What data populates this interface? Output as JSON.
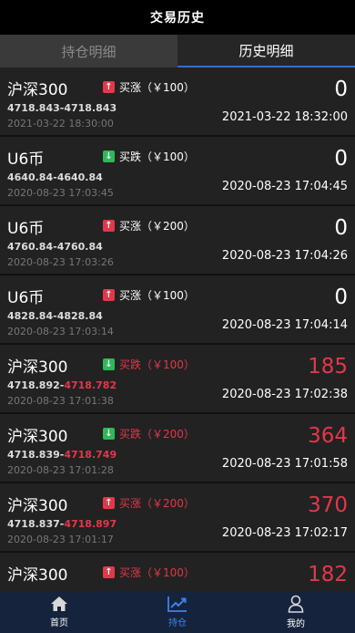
{
  "header": {
    "title": "交易历史"
  },
  "tabs": [
    {
      "label": "持仓明细",
      "active": false
    },
    {
      "label": "历史明细",
      "active": true
    }
  ],
  "trades": [
    {
      "name": "沪深300",
      "direction": "up",
      "direction_text": "买涨（￥100）",
      "open_price": "4718.843",
      "close_price": "4718.843",
      "open_time": "2021-03-22 18:30:00",
      "pnl": "0",
      "close_time": "2021-03-22 18:32:00",
      "loss": false
    },
    {
      "name": "U6币",
      "direction": "down",
      "direction_text": "买跌（￥100）",
      "open_price": "4640.84",
      "close_price": "4640.84",
      "open_time": "2020-08-23 17:03:45",
      "pnl": "0",
      "close_time": "2020-08-23 17:04:45",
      "loss": false
    },
    {
      "name": "U6币",
      "direction": "up",
      "direction_text": "买涨（￥200）",
      "open_price": "4760.84",
      "close_price": "4760.84",
      "open_time": "2020-08-23 17:03:26",
      "pnl": "0",
      "close_time": "2020-08-23 17:04:26",
      "loss": false
    },
    {
      "name": "U6币",
      "direction": "up",
      "direction_text": "买涨（￥100）",
      "open_price": "4828.84",
      "close_price": "4828.84",
      "open_time": "2020-08-23 17:03:14",
      "pnl": "0",
      "close_time": "2020-08-23 17:04:14",
      "loss": false
    },
    {
      "name": "沪深300",
      "direction": "down",
      "direction_text": "买跌（￥100）",
      "open_price": "4718.892",
      "close_price": "4718.782",
      "open_time": "2020-08-23 17:01:38",
      "pnl": "185",
      "close_time": "2020-08-23 17:02:38",
      "loss": true
    },
    {
      "name": "沪深300",
      "direction": "down",
      "direction_text": "买跌（￥200）",
      "open_price": "4718.839",
      "close_price": "4718.749",
      "open_time": "2020-08-23 17:01:28",
      "pnl": "364",
      "close_time": "2020-08-23 17:01:58",
      "loss": true
    },
    {
      "name": "沪深300",
      "direction": "up",
      "direction_text": "买涨（￥200）",
      "open_price": "4718.837",
      "close_price": "4718.897",
      "open_time": "2020-08-23 17:01:17",
      "pnl": "370",
      "close_time": "2020-08-23 17:02:17",
      "loss": true
    },
    {
      "name": "沪深300",
      "direction": "up",
      "direction_text": "买涨（￥100）",
      "open_price": "",
      "close_price": "",
      "open_time": "",
      "pnl": "182",
      "close_time": "",
      "loss": true
    }
  ],
  "nav": [
    {
      "label": "首页",
      "icon": "home-icon",
      "active": false
    },
    {
      "label": "持仓",
      "icon": "trend-chart-icon",
      "active": true
    },
    {
      "label": "我的",
      "icon": "user-icon",
      "active": false
    }
  ],
  "colors": {
    "loss_red": "#e1384a",
    "rise_icon": "#e1384a",
    "fall_icon": "#2fb85a",
    "accent_blue": "#3d82e6",
    "tab_underline": "#2f6fd1"
  }
}
